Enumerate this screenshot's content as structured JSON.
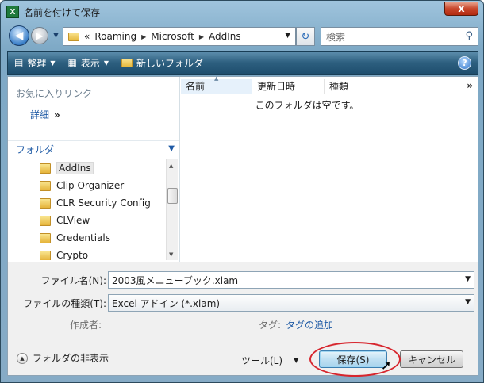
{
  "window": {
    "title": "名前を付けて保存",
    "app_icon": "X",
    "close_label": "x"
  },
  "nav": {
    "path": [
      "«",
      "Roaming",
      "Microsoft",
      "AddIns"
    ],
    "search_placeholder": "検索"
  },
  "toolbar": {
    "organize": "整理",
    "views": "表示",
    "new_folder": "新しいフォルダ",
    "help": "?"
  },
  "left_pane": {
    "favorites_header": "お気に入りリンク",
    "detail_link": "詳細",
    "folders_header": "フォルダ",
    "folders": [
      "AddIns",
      "Clip Organizer",
      "CLR Security Config",
      "CLView",
      "Credentials",
      "Crypto"
    ],
    "selected_folder": "AddIns"
  },
  "file_list": {
    "columns": [
      "名前",
      "更新日時",
      "種類"
    ],
    "more": "»",
    "empty_message": "このフォルダは空です。"
  },
  "form": {
    "filename_label": "ファイル名(N):",
    "filename_value": "2003風メニューブック.xlam",
    "filetype_label": "ファイルの種類(T):",
    "filetype_value": "Excel アドイン (*.xlam)",
    "author_label": "作成者:",
    "tags_label": "タグ:",
    "tags_link": "タグの追加"
  },
  "footer": {
    "hide_folders": "フォルダの非表示",
    "tools": "ツール(L)",
    "save": "保存(S)",
    "cancel": "キャンセル"
  },
  "colors": {
    "accent": "#1e5aa5",
    "highlight_ring": "#d7262e",
    "toolbar": "#2d5f7f"
  }
}
